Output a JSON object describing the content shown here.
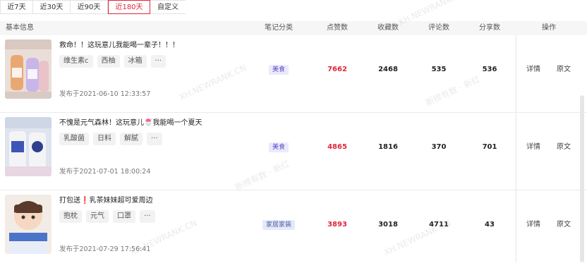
{
  "filters": {
    "tabs": [
      "近7天",
      "近30天",
      "近90天",
      "近180天",
      "自定义"
    ],
    "active": "近180天"
  },
  "table": {
    "columns": {
      "basic": "基本信息",
      "category": "笔记分类",
      "likes": "点赞数",
      "collects": "收藏数",
      "comments": "评论数",
      "shares": "分享数",
      "actions": "操作"
    },
    "rows": [
      {
        "title": "救命！！这玩意儿我能喝一辈子！！！",
        "tags": [
          "维生素c",
          "西柚",
          "冰箱",
          "···"
        ],
        "date": "发布于2021-06-10 12:33:57",
        "category": "美食",
        "likes": "7662",
        "collects": "2468",
        "comments": "535",
        "shares": "536",
        "detail": "详情",
        "original": "原文"
      },
      {
        "title": "不愧是元气森林！这玩意儿🍧我能喝一个夏天",
        "tags": [
          "乳酸菌",
          "日料",
          "解腻",
          "···"
        ],
        "date": "发布于2021-07-01 18:00:24",
        "category": "美食",
        "likes": "4865",
        "collects": "1816",
        "comments": "370",
        "shares": "701",
        "detail": "详情",
        "original": "原文"
      },
      {
        "title": "打包送❗乳茶妹妹超可爱周边",
        "tags": [
          "抱枕",
          "元气",
          "口罩",
          "···"
        ],
        "date": "发布于2021-07-29 17:56:41",
        "category": "家居家装",
        "likes": "3893",
        "collects": "3018",
        "comments": "4711",
        "shares": "43",
        "detail": "详情",
        "original": "原文"
      }
    ]
  },
  "watermarks": [
    "XH.NEWRANK.CN",
    "新榜有数 · 新红"
  ],
  "colors": {
    "accent": "#e0253a",
    "cat_food_bg": "#ece9fb",
    "cat_food_fg": "#5a4fcf",
    "cat_home_bg": "#e6eaf8",
    "cat_home_fg": "#4a5ca8"
  }
}
